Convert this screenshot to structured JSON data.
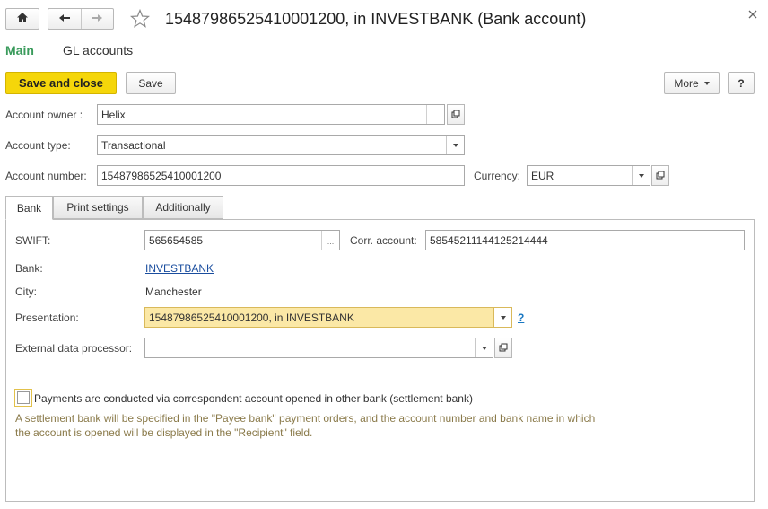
{
  "window": {
    "title": "15487986525410001200, in INVESTBANK (Bank account)"
  },
  "nav": {
    "tabs": [
      {
        "label": "Main"
      },
      {
        "label": "GL accounts"
      }
    ]
  },
  "toolbar": {
    "save_close_label": "Save and close",
    "save_label": "Save",
    "more_label": "More",
    "help_label": "?"
  },
  "form": {
    "owner": {
      "label": "Account owner :",
      "value": "Helix"
    },
    "type": {
      "label": "Account type:",
      "value": "Transactional"
    },
    "number": {
      "label": "Account number:",
      "value": "15487986525410001200"
    },
    "currency": {
      "label": "Currency:",
      "value": "EUR"
    }
  },
  "section_tabs": [
    {
      "label": "Bank"
    },
    {
      "label": "Print settings"
    },
    {
      "label": "Additionally"
    }
  ],
  "bank": {
    "swift": {
      "label": "SWIFT:",
      "value": "565654585"
    },
    "corr": {
      "label": "Corr. account:",
      "value": "58545211144125214444"
    },
    "bank": {
      "label": "Bank:",
      "value": "INVESTBANK"
    },
    "city": {
      "label": "City:",
      "value": "Manchester"
    },
    "presentation": {
      "label": "Presentation:",
      "value": "15487986525410001200, in INVESTBANK",
      "help": "?"
    },
    "ext_processor": {
      "label": "External data processor:",
      "value": ""
    },
    "checkbox_label": "Payments are conducted via correspondent account opened in other bank (settlement bank)",
    "note_line1": "A settlement bank will be specified in the \"Payee bank\" payment orders, and the account number and bank name in which",
    "note_line2": "the account is opened will be displayed in the \"Recipient\" field."
  },
  "colors": {
    "accent_green": "#3a9b5c",
    "primary_button": "#f5d60a",
    "highlight_field": "#fbe8a6",
    "link": "#1a4d9e",
    "note_text": "#8a7a4a"
  },
  "icons": {
    "home": "home-icon",
    "back": "arrow-left-icon",
    "forward": "arrow-right-icon",
    "favorite": "star-icon",
    "close": "close-icon"
  }
}
